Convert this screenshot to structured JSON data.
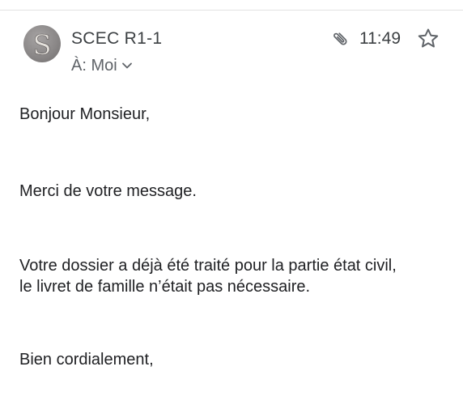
{
  "email": {
    "sender": {
      "name": "SCEC R1-1",
      "avatar_letter": "S",
      "avatar_icon": "avatar-icon"
    },
    "recipient": {
      "label": "À: Moi",
      "expand_icon": "chevron-down-icon"
    },
    "has_attachment": true,
    "attachment_icon": "paperclip-icon",
    "time": "11:49",
    "star_icon": "star-outline-icon",
    "starred": false,
    "body": {
      "greeting": "Bonjour Monsieur,",
      "thanks": "Merci de votre message.",
      "paragraph_line_1": "Votre dossier a déjà été traité pour la partie état civil,",
      "paragraph_line_2": "le livret de famille n’était pas nécessaire.",
      "closing": "Bien cordialement,"
    }
  },
  "colors": {
    "text_primary": "#202124",
    "text_secondary": "#5f6368",
    "avatar_bg": "#8b8888",
    "icon": "#5f6368"
  }
}
